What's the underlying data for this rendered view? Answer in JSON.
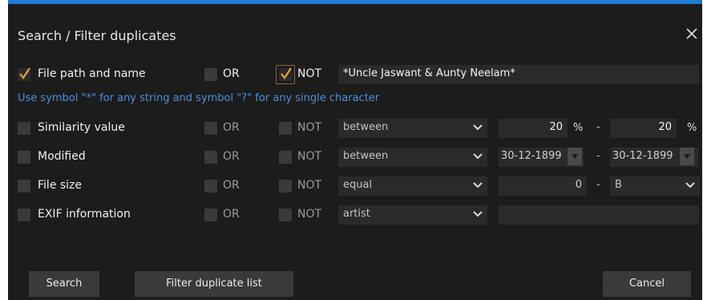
{
  "dialog": {
    "title": "Search / Filter duplicates",
    "close_icon": "close-icon"
  },
  "colors": {
    "accent": "#1e7ad6",
    "background": "#1c1c1c",
    "field": "#2a2a2a",
    "check": "#f0a030",
    "hint": "#4d8fd8"
  },
  "filters": {
    "file_path": {
      "label": "File path and name",
      "checked": true,
      "or_label": "OR",
      "or_checked": false,
      "not_label": "NOT",
      "not_checked": true,
      "value": "*Uncle Jaswant & Aunty Neelam*",
      "hint": "Use symbol \"*\" for any string and symbol \"?\" for any single character"
    },
    "similarity": {
      "label": "Similarity value",
      "checked": false,
      "or_label": "OR",
      "not_label": "NOT",
      "operator": "between",
      "from": "20",
      "from_unit": "%",
      "dash": "-",
      "to": "20",
      "to_unit": "%"
    },
    "modified": {
      "label": "Modified",
      "checked": false,
      "or_label": "OR",
      "not_label": "NOT",
      "operator": "between",
      "from": "30-12-1899",
      "dash": "-",
      "to": "30-12-1899"
    },
    "file_size": {
      "label": "File size",
      "checked": false,
      "or_label": "OR",
      "not_label": "NOT",
      "operator": "equal",
      "value": "0",
      "dash": "-",
      "unit": "B"
    },
    "exif": {
      "label": "EXIF information",
      "checked": false,
      "or_label": "OR",
      "not_label": "NOT",
      "operator": "artist",
      "value": ""
    }
  },
  "buttons": {
    "search": "Search",
    "filter": "Filter duplicate list",
    "cancel": "Cancel"
  }
}
